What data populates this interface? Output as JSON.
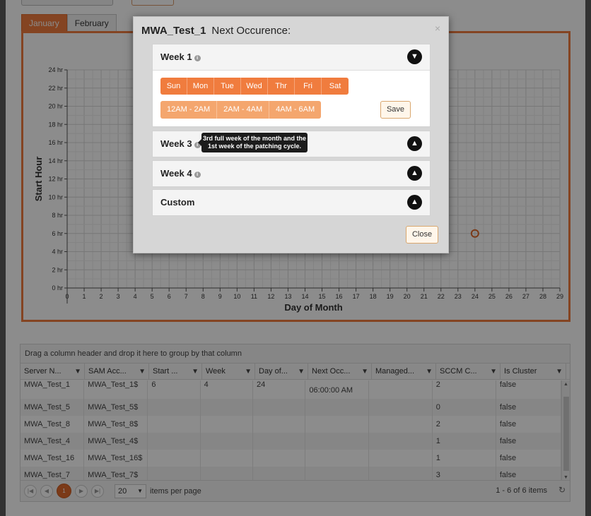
{
  "tabs": [
    "January",
    "February"
  ],
  "chart_data": {
    "type": "scatter",
    "title": "",
    "xlabel": "Day of Month",
    "ylabel": "Start Hour",
    "x_ticks": [
      "0",
      "1",
      "2",
      "3",
      "4",
      "5",
      "6",
      "7",
      "8",
      "9",
      "10",
      "11",
      "12",
      "13",
      "14",
      "15",
      "16",
      "17",
      "18",
      "19",
      "20",
      "21",
      "22",
      "23",
      "24",
      "25",
      "26",
      "27",
      "28",
      "29"
    ],
    "y_ticks": [
      "0 hr",
      "2 hr",
      "4 hr",
      "6 hr",
      "8 hr",
      "10 hr",
      "12 hr",
      "14 hr",
      "16 hr",
      "18 hr",
      "20 hr",
      "22 hr",
      "24 hr"
    ],
    "xlim": [
      0,
      29
    ],
    "ylim": [
      0,
      24
    ],
    "grid": true,
    "points": [
      {
        "x": 24,
        "y": 6
      }
    ],
    "marker_color": "#e06a2c"
  },
  "modal": {
    "title": "MWA_Test_1",
    "subtitle": "Next Occurence:",
    "close_icon": "×",
    "week1": {
      "label": "Week 1",
      "days": [
        "Sun",
        "Mon",
        "Tue",
        "Wed",
        "Thr",
        "Fri",
        "Sat"
      ],
      "times": [
        "12AM - 2AM",
        "2AM - 4AM",
        "4AM - 6AM"
      ],
      "save": "Save"
    },
    "week3": {
      "label": "Week 3"
    },
    "week4": {
      "label": "Week 4"
    },
    "custom": {
      "label": "Custom"
    },
    "tooltip_line1": "3rd full week of the month and the",
    "tooltip_line2": "1st week of the patching cycle.",
    "close": "Close"
  },
  "grid": {
    "group_hint": "Drag a column header and drop it here to group by that column",
    "columns": [
      "Server N...",
      "SAM Acc...",
      "Start ...",
      "Week",
      "Day of...",
      "Next Occ...",
      "Managed...",
      "SCCM C...",
      "Is Cluster"
    ],
    "rows": [
      [
        "MWA_Test_1",
        "MWA_Test_1$",
        "6",
        "4",
        "24",
        "06:00:00 AM",
        "",
        "2",
        "false"
      ],
      [
        "MWA_Test_5",
        "MWA_Test_5$",
        "",
        "",
        "",
        "",
        "",
        "0",
        "false"
      ],
      [
        "MWA_Test_8",
        "MWA_Test_8$",
        "",
        "",
        "",
        "",
        "",
        "2",
        "false"
      ],
      [
        "MWA_Test_4",
        "MWA_Test_4$",
        "",
        "",
        "",
        "",
        "",
        "1",
        "false"
      ],
      [
        "MWA_Test_16",
        "MWA_Test_16$",
        "",
        "",
        "",
        "",
        "",
        "1",
        "false"
      ],
      [
        "MWA_Test_7",
        "MWA_Test_7$",
        "",
        "",
        "",
        "",
        "",
        "3",
        "false"
      ]
    ],
    "pager": {
      "current_page": "1",
      "page_size": "20",
      "per_page_label": "items per page",
      "count": "1 - 6 of 6 items"
    }
  }
}
